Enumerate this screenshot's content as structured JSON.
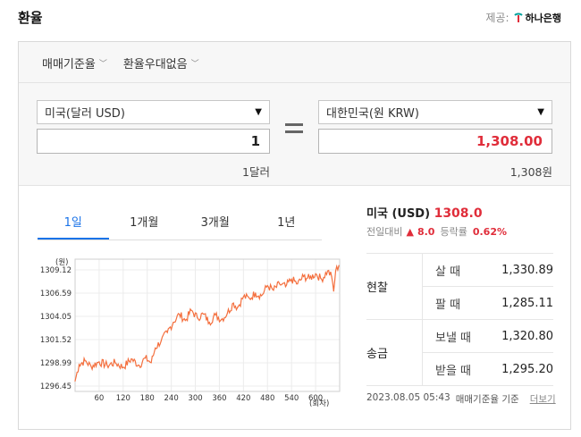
{
  "header": {
    "title": "환율",
    "provider_label": "제공:",
    "bank_name": "하나은행"
  },
  "options": [
    {
      "label": "매매기준율"
    },
    {
      "label": "환율우대없음"
    }
  ],
  "converter": {
    "from_currency": "미국(달러 USD)",
    "from_amount": "1",
    "from_unit": "1달러",
    "to_currency": "대한민국(원 KRW)",
    "to_amount": "1,308.00",
    "to_unit": "1,308원"
  },
  "tabs": [
    {
      "label": "1일",
      "active": true
    },
    {
      "label": "1개월"
    },
    {
      "label": "3개월"
    },
    {
      "label": "1년"
    }
  ],
  "summary": {
    "country": "미국 (USD)",
    "rate": "1308.0",
    "change_label": "전일대비",
    "change_value": "8.0",
    "rate_label": "등락률",
    "rate_value": "0.62%"
  },
  "table": [
    {
      "group": "현찰",
      "rows": [
        {
          "label": "살 때",
          "value": "1,330.89"
        },
        {
          "label": "팔 때",
          "value": "1,285.11"
        }
      ]
    },
    {
      "group": "송금",
      "rows": [
        {
          "label": "보낼 때",
          "value": "1,320.80"
        },
        {
          "label": "받을 때",
          "value": "1,295.20"
        }
      ]
    }
  ],
  "footer": {
    "timestamp": "2023.08.05 05:43",
    "basis": "매매기준율 기준",
    "more_label": "더보기"
  },
  "colors": {
    "accent_blue": "#1a73e8",
    "up_red": "#e02d3a",
    "line": "#f4703f"
  },
  "chart_data": {
    "type": "line",
    "ylabel": "(원)",
    "xlabel": "(회차)",
    "yticks": [
      "1309.12",
      "1306.59",
      "1304.05",
      "1301.52",
      "1298.99",
      "1296.45"
    ],
    "ylim": [
      1296.45,
      1309.12
    ],
    "xticks": [
      60,
      120,
      180,
      240,
      300,
      360,
      420,
      480,
      540,
      600
    ],
    "xlim": [
      0,
      660
    ],
    "grid": true,
    "series": [
      {
        "x": [
          0,
          10,
          25,
          40,
          60,
          80,
          100,
          120,
          140,
          160,
          175,
          190,
          200,
          215,
          230,
          245,
          260,
          275,
          290,
          305,
          320,
          335,
          350,
          365,
          380,
          395,
          405,
          420,
          435,
          450,
          465,
          480,
          495,
          510,
          525,
          540,
          555,
          570,
          585,
          600,
          615,
          630,
          640,
          645,
          650,
          658
        ],
        "y": [
          1297.0,
          1298.8,
          1299.2,
          1298.6,
          1299.1,
          1298.7,
          1299.0,
          1298.5,
          1299.4,
          1298.7,
          1299.5,
          1299.0,
          1300.6,
          1301.4,
          1302.3,
          1303.4,
          1304.3,
          1303.6,
          1304.7,
          1303.9,
          1304.3,
          1303.4,
          1304.2,
          1303.7,
          1304.4,
          1305.5,
          1305.0,
          1306.2,
          1306.0,
          1306.6,
          1306.3,
          1307.4,
          1306.9,
          1307.6,
          1307.3,
          1308.1,
          1307.6,
          1308.4,
          1308.2,
          1308.7,
          1308.1,
          1309.0,
          1308.4,
          1306.8,
          1309.0,
          1309.6
        ]
      }
    ]
  }
}
